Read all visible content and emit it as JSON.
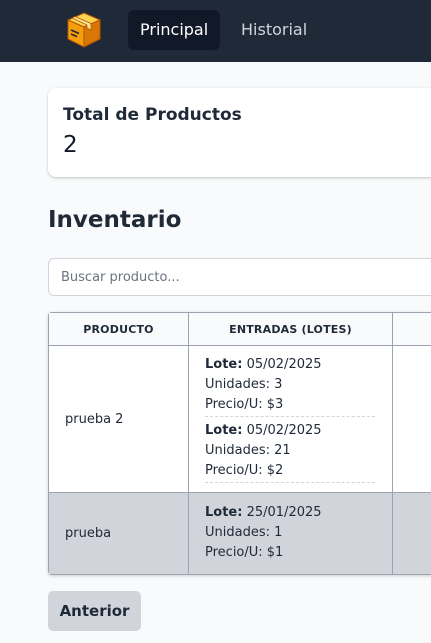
{
  "nav": {
    "logo_icon": "package-box-icon",
    "tabs": [
      {
        "label": "Principal",
        "active": true
      },
      {
        "label": "Historial",
        "active": false
      }
    ]
  },
  "stats": {
    "title": "Total de Productos",
    "value": "2"
  },
  "inventory": {
    "title": "Inventario",
    "search_placeholder": "Buscar producto...",
    "search_value": "",
    "columns": [
      "PRODUCTO",
      "ENTRADAS (LOTES)",
      ""
    ],
    "rows": [
      {
        "product": "prueba 2",
        "lots": [
          {
            "lote_label": "Lote:",
            "date": "05/02/2025",
            "units": "Unidades: 3",
            "price": "Precio/U: $3"
          },
          {
            "lote_label": "Lote:",
            "date": "05/02/2025",
            "units": "Unidades: 21",
            "price": "Precio/U: $2"
          }
        ],
        "extra": "-"
      },
      {
        "product": "prueba",
        "lots": [
          {
            "lote_label": "Lote:",
            "date": "25/01/2025",
            "units": "Unidades: 1",
            "price": "Precio/U: $1"
          }
        ],
        "extra": "-"
      }
    ]
  },
  "pagination": {
    "prev_label": "Anterior"
  },
  "colors": {
    "navbar": "#1f2937",
    "active_tab": "#111827",
    "row_highlight": "#d1d5db"
  }
}
